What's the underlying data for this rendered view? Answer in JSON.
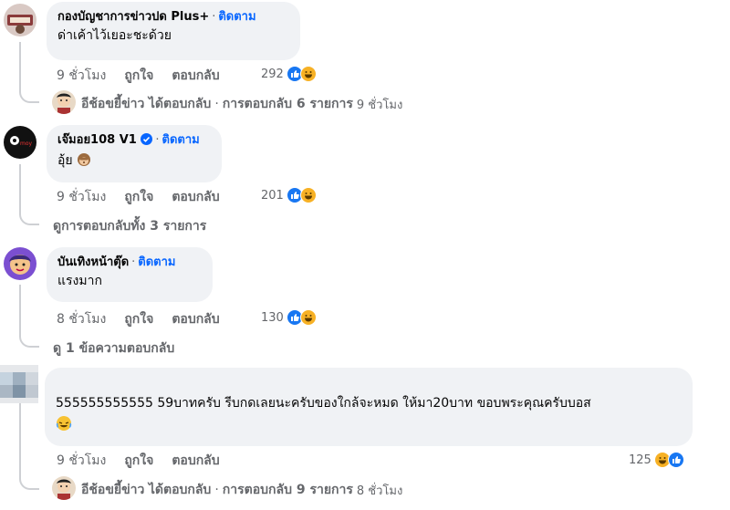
{
  "comments": [
    {
      "author": "กองบัญชาการข่าวปด Plus+",
      "follow": "ติดตาม",
      "text": "ด่าเค้าไว้เยอะชะด้วย",
      "time": "9 ชั่วโมง",
      "like": "ถูกใจ",
      "reply": "ตอบกลับ",
      "reaction_count": "292",
      "reply_summary": {
        "name": "อีช้อขยี้ข่าว",
        "replied": "ได้ตอบกลับ",
        "count_text": "การตอบกลับ 6 รายการ",
        "time": "9 ชั่วโมง"
      }
    },
    {
      "author": "เจ๊มอย108 V1",
      "follow": "ติดตาม",
      "text": "อุ้ย",
      "time": "9 ชั่วโมง",
      "like": "ถูกใจ",
      "reply": "ตอบกลับ",
      "reaction_count": "201",
      "view_replies": "ดูการตอบกลับทั้ง 3 รายการ"
    },
    {
      "author": "บันเทิงหน้าตุ๊ด",
      "follow": "ติดตาม",
      "text": "แรงมาก",
      "time": "8 ชั่วโมง",
      "like": "ถูกใจ",
      "reply": "ตอบกลับ",
      "reaction_count": "130",
      "view_replies": "ดู 1 ข้อความตอบกลับ"
    },
    {
      "author": "",
      "text": "555555555555 59บาทครับ รีบกดเลยนะครับของใกล้จะหมด ให้มา20บาท ขอบพระคุณครับบอส",
      "time": "9 ชั่วโมง",
      "like": "ถูกใจ",
      "reply": "ตอบกลับ",
      "reaction_count": "125",
      "reply_summary": {
        "name": "อีช้อขยี้ข่าว",
        "replied": "ได้ตอบกลับ",
        "count_text": "การตอบกลับ 9 รายการ",
        "time": "8 ชั่วโมง"
      }
    }
  ],
  "colors": {
    "bubble": "#f0f2f5",
    "link": "#0866ff",
    "secondary_text": "#65676b",
    "like": "#1877f2",
    "haha": "#f7b125"
  },
  "icons": [
    "like-icon",
    "haha-icon",
    "verified-badge-icon",
    "monkey-emoji",
    "laugh-tears-emoji"
  ]
}
